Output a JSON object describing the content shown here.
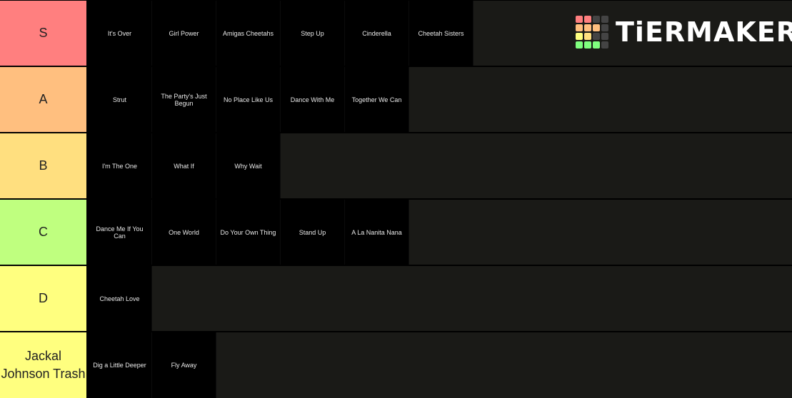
{
  "logo": {
    "text": "TiERMAKER",
    "grid_colors": [
      "#ff7f7f",
      "#ff7f7f",
      "#444444",
      "#444444",
      "#ffbf7f",
      "#ffbf7f",
      "#ffbf7f",
      "#444444",
      "#ffff7f",
      "#ffdf7f",
      "#444444",
      "#444444",
      "#7fff7f",
      "#7fff7f",
      "#7fff7f",
      "#444444"
    ]
  },
  "tiers": [
    {
      "label": "S",
      "color": "#ff7f7f",
      "items": [
        "It's Over",
        "Girl Power",
        "Amigas Cheetahs",
        "Step Up",
        "Cinderella",
        "Cheetah Sisters"
      ]
    },
    {
      "label": "A",
      "color": "#ffbf7f",
      "items": [
        "Strut",
        "The Party's Just Begun",
        "No Place Like Us",
        "Dance With Me",
        "Together We Can"
      ]
    },
    {
      "label": "B",
      "color": "#ffdf7f",
      "items": [
        "I'm The One",
        "What If",
        "Why Wait"
      ]
    },
    {
      "label": "C",
      "color": "#bfff7f",
      "items": [
        "Dance Me If You Can",
        "One World",
        "Do Your Own Thing",
        "Stand Up",
        "A La Nanita Nana"
      ]
    },
    {
      "label": "D",
      "color": "#ffff7f",
      "items": [
        "Cheetah Love"
      ]
    },
    {
      "label": "Jackal Johnson Trash",
      "color": "#ffff7f",
      "items": [
        "Dig a Little Deeper",
        "Fly Away"
      ]
    }
  ]
}
